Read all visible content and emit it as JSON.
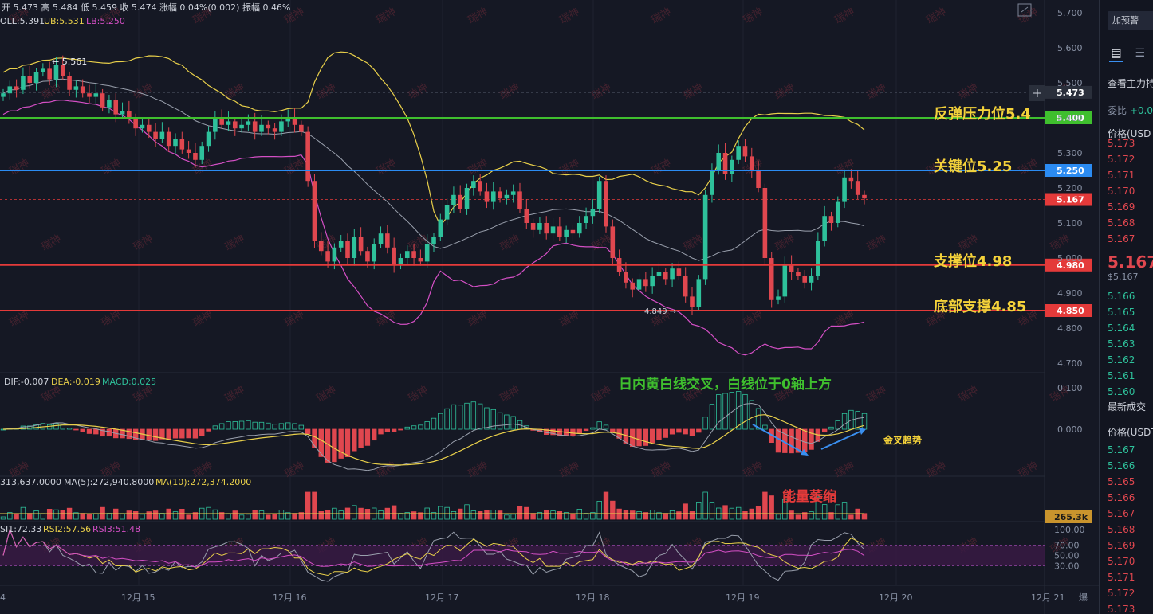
{
  "header": {
    "ohlc": "开 5.473 高 5.484 低 5.459 收 5.474 涨幅 0.04%(0.002) 振幅 0.46%",
    "boll_mid": "OLL:5.391",
    "boll_ub": "UB:5.531",
    "boll_lb": "LB:5.250"
  },
  "macd_legend": {
    "dif": "DIF:-0.007",
    "dea": "DEA:-0.019",
    "macd": "MACD:0.025"
  },
  "vol_legend": {
    "vol": "313,637.0000",
    "ma5": "MA(5):272,940.8000",
    "ma10": "MA(10):272,374.2000"
  },
  "rsi_legend": {
    "rsi1": "SI1:72.33",
    "rsi2": "RSI2:57.56",
    "rsi3": "RSI3:51.48"
  },
  "annotations": {
    "resistance": "反弹压力位5.4",
    "key": "关键位5.25",
    "support": "支撑位4.98",
    "bottom": "底部支撑4.85",
    "macd_note": "日内黄白线交叉，白线位于0轴上方",
    "golden": "金叉趋势",
    "volume_note": "能量萎缩",
    "high_marker": "← 5.561",
    "low_marker": "4.849 →",
    "watermark": "瑞神"
  },
  "colors": {
    "up": "#2ec19b",
    "down": "#e0474f",
    "bg": "#151824",
    "line_540": "#3fbf2e",
    "line_525": "#2b8bf2",
    "line_498": "#e43a3a",
    "line_485": "#e43a3a",
    "boll": "#e9d04a",
    "boll_lb": "#d44fc5",
    "mid": "#9aa0ad",
    "annot_yellow": "#f4d23a"
  },
  "chart_data": {
    "type": "candlestick",
    "y_ticks": [
      "5.700",
      "5.600",
      "5.500",
      "5.400",
      "5.300",
      "5.200",
      "5.100",
      "5.000",
      "4.900",
      "4.800",
      "4.700"
    ],
    "ylim": [
      4.68,
      5.73
    ],
    "price_tags": [
      {
        "label": "5.473",
        "value": 5.473,
        "color": "#2a2f3b"
      },
      {
        "label": "5.400",
        "value": 5.4,
        "color": "#3fbf2e"
      },
      {
        "label": "5.250",
        "value": 5.25,
        "color": "#2b8bf2"
      },
      {
        "label": "5.167",
        "value": 5.167,
        "color": "#e43a3a"
      },
      {
        "label": "4.980",
        "value": 4.98,
        "color": "#e43a3a"
      },
      {
        "label": "4.850",
        "value": 4.85,
        "color": "#e43a3a"
      }
    ],
    "x_labels": [
      "4",
      "12月 15",
      "12月 16",
      "12月 17",
      "12月 18",
      "12月 19",
      "12月 20",
      "12月 21"
    ],
    "x_extra": "爆",
    "close": [
      5.47,
      5.49,
      5.48,
      5.52,
      5.5,
      5.53,
      5.54,
      5.51,
      5.55,
      5.52,
      5.48,
      5.49,
      5.47,
      5.46,
      5.47,
      5.43,
      5.45,
      5.41,
      5.42,
      5.4,
      5.37,
      5.38,
      5.36,
      5.34,
      5.36,
      5.32,
      5.34,
      5.31,
      5.3,
      5.28,
      5.32,
      5.36,
      5.4,
      5.38,
      5.39,
      5.37,
      5.38,
      5.39,
      5.36,
      5.38,
      5.37,
      5.36,
      5.39,
      5.4,
      5.38,
      5.36,
      5.22,
      5.05,
      5.02,
      4.99,
      5.03,
      5.05,
      5.0,
      5.06,
      5.02,
      4.99,
      5.04,
      5.07,
      5.03,
      4.98,
      5.0,
      5.02,
      5.0,
      4.99,
      5.04,
      5.06,
      5.11,
      5.15,
      5.18,
      5.14,
      5.2,
      5.22,
      5.19,
      5.16,
      5.19,
      5.17,
      5.18,
      5.19,
      5.14,
      5.1,
      5.08,
      5.1,
      5.07,
      5.09,
      5.06,
      5.08,
      5.07,
      5.1,
      5.12,
      5.14,
      5.22,
      5.09,
      5.0,
      4.96,
      4.93,
      4.91,
      4.94,
      4.92,
      4.95,
      4.96,
      4.94,
      4.97,
      4.95,
      4.89,
      4.86,
      4.94,
      5.18,
      5.25,
      5.3,
      5.24,
      5.28,
      5.32,
      5.29,
      5.25,
      5.2,
      5.0,
      4.88,
      4.89,
      4.98,
      4.96,
      4.95,
      4.93,
      4.95,
      5.05,
      5.12,
      5.1,
      5.16,
      5.23,
      5.22,
      5.18,
      5.17
    ],
    "macd_hist_ylim": [
      -0.09,
      0.11
    ],
    "macd_ticks": [
      "0.100",
      "0.000"
    ],
    "rsi_ticks": [
      "100.00",
      "70.00",
      "50.00",
      "30.00"
    ],
    "vol_tag": "265.3k"
  },
  "sidebar": {
    "alert_button": "加预警",
    "tab1_icon": "chart-icon",
    "tab2_icon": "list-icon",
    "main_pos": "查看主力持",
    "wei_bi": "委比",
    "wei_bi_val": "+0.0",
    "price_head": "价格(USD",
    "asks": [
      "5.173",
      "5.172",
      "5.171",
      "5.170",
      "5.169",
      "5.168",
      "5.167"
    ],
    "last": "5.167",
    "last_sub": "$5.167",
    "bids": [
      "5.166",
      "5.165",
      "5.164",
      "5.163",
      "5.162",
      "5.161",
      "5.160"
    ],
    "trades_head": "最新成交",
    "trade_price_head": "价格(USDT",
    "trades": [
      {
        "p": "5.167",
        "c": "green"
      },
      {
        "p": "5.166",
        "c": "green"
      },
      {
        "p": "5.165",
        "c": "red"
      },
      {
        "p": "5.166",
        "c": "red"
      },
      {
        "p": "5.167",
        "c": "red"
      },
      {
        "p": "5.168",
        "c": "red"
      },
      {
        "p": "5.169",
        "c": "red"
      },
      {
        "p": "5.170",
        "c": "red"
      },
      {
        "p": "5.171",
        "c": "red"
      },
      {
        "p": "5.172",
        "c": "red"
      },
      {
        "p": "5.173",
        "c": "red"
      }
    ]
  }
}
